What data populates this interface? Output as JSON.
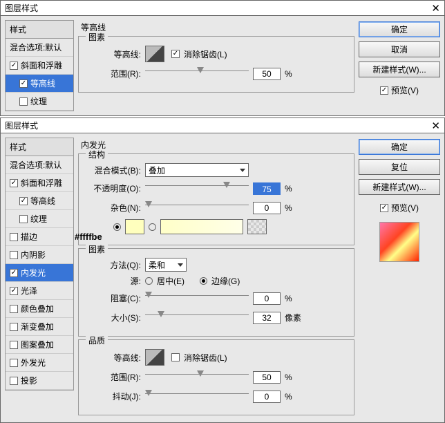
{
  "dialog1": {
    "title": "图层样式",
    "stylesHeader": "样式",
    "blendDefault": "混合选项:默认",
    "items": [
      {
        "label": "斜面和浮雕",
        "checked": true,
        "selected": false,
        "indent": false
      },
      {
        "label": "等高线",
        "checked": true,
        "selected": true,
        "indent": true
      },
      {
        "label": "纹理",
        "checked": false,
        "selected": false,
        "indent": true
      }
    ],
    "sectionTitle": "等高线",
    "group": "图素",
    "contourLabel": "等高线:",
    "antialias": "消除锯齿(L)",
    "rangeLabel": "范围(R):",
    "rangeValue": "50",
    "percent": "%",
    "ok": "确定",
    "cancel": "取消",
    "newStyle": "新建样式(W)...",
    "preview": "预览(V)"
  },
  "dialog2": {
    "title": "图层样式",
    "stylesHeader": "样式",
    "blendDefault": "混合选项:默认",
    "items": [
      {
        "label": "斜面和浮雕",
        "checked": true
      },
      {
        "label": "等高线",
        "checked": true,
        "indent": true
      },
      {
        "label": "纹理",
        "checked": false,
        "indent": true
      },
      {
        "label": "描边",
        "checked": false
      },
      {
        "label": "内阴影",
        "checked": false
      },
      {
        "label": "内发光",
        "checked": true,
        "selected": true
      },
      {
        "label": "光泽",
        "checked": true
      },
      {
        "label": "颜色叠加",
        "checked": false
      },
      {
        "label": "渐变叠加",
        "checked": false
      },
      {
        "label": "图案叠加",
        "checked": false
      },
      {
        "label": "外发光",
        "checked": false
      },
      {
        "label": "投影",
        "checked": false
      }
    ],
    "sectionTitle": "内发光",
    "struct": "结构",
    "blendModeLabel": "混合模式(B):",
    "blendModeValue": "叠加",
    "opacityLabel": "不透明度(O):",
    "opacityValue": "75",
    "noiseLabel": "杂色(N):",
    "noiseValue": "0",
    "colorNote": "#ffffbe",
    "elements": "图素",
    "methodLabel": "方法(Q):",
    "methodValue": "柔和",
    "sourceLabel": "源:",
    "sourceCenter": "居中(E)",
    "sourceEdge": "边缘(G)",
    "chokeLabel": "阻塞(C):",
    "chokeValue": "0",
    "sizeLabel": "大小(S):",
    "sizeValue": "32",
    "px": "像素",
    "quality": "品质",
    "contourLabel": "等高线:",
    "antialias": "消除锯齿(L)",
    "rangeLabel": "范围(R):",
    "rangeValue": "50",
    "jitterLabel": "抖动(J):",
    "jitterValue": "0",
    "percent": "%",
    "ok": "确定",
    "reset": "复位",
    "newStyle": "新建样式(W)...",
    "preview": "预览(V)"
  }
}
